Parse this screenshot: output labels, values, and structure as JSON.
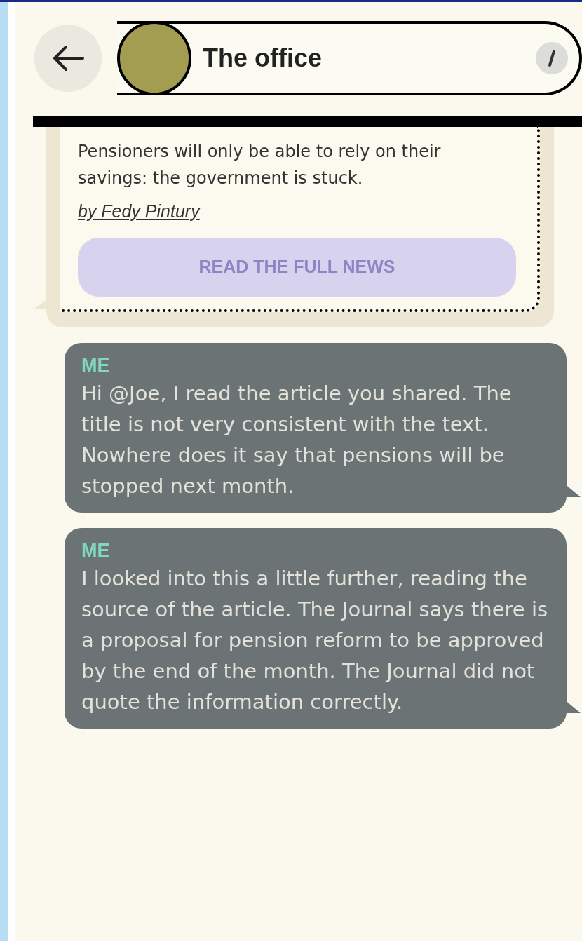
{
  "header": {
    "title": "The office"
  },
  "news_card": {
    "summary": "Pensioners will only be able to rely on their savings: the government is stuck.",
    "author": "by Fedy Pintury",
    "button": {
      "label": "READ THE FULL NEWS",
      "disabled": true
    }
  },
  "messages": [
    {
      "sender": "ME",
      "text": "Hi @Joe, I read the article you shared. The title is not very consistent with the text. Nowhere does it say that pensions will be stopped next month.",
      "outgoing": true
    },
    {
      "sender": "ME",
      "text": "I looked into this a little further, reading the source of the article. The Journal says there is a proposal for pension reform to be approved by the end of the month. The Journal did not quote the information correctly.",
      "outgoing": true
    }
  ]
}
